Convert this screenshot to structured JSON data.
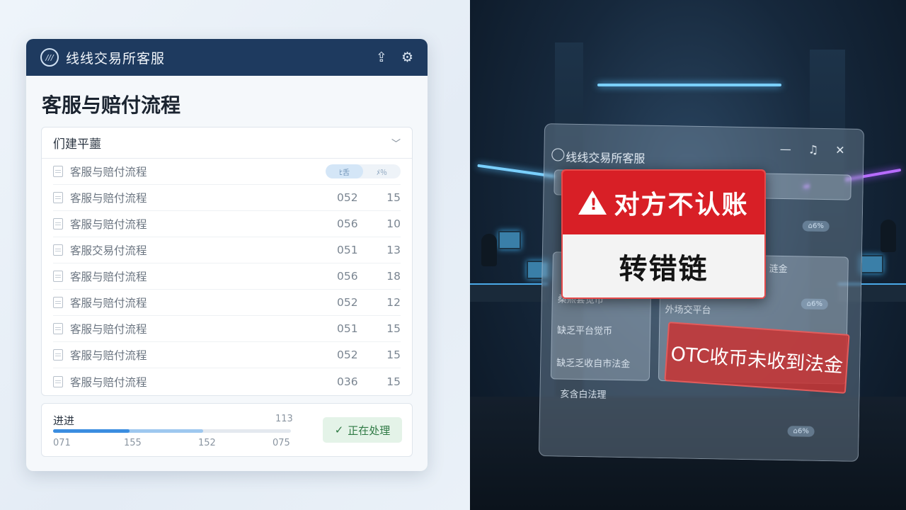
{
  "app": {
    "title": "线线交易所客服",
    "logo_text": "///",
    "share_icon": "share-icon",
    "settings_icon": "gear-icon"
  },
  "page_title": "客服与赔付流程",
  "dropdown": {
    "label": "们建平蘁"
  },
  "toggle": {
    "left": "ﾋ舌",
    "right": "ﾒ％"
  },
  "rows": [
    {
      "name": "客服与赔付流程",
      "c1": "",
      "c2": ""
    },
    {
      "name": "客服与赔付流程",
      "c1": "052",
      "c2": "15"
    },
    {
      "name": "客服与赔付流程",
      "c1": "056",
      "c2": "10"
    },
    {
      "name": "客服交易付流程",
      "c1": "051",
      "c2": "13"
    },
    {
      "name": "客服与赔付流程",
      "c1": "056",
      "c2": "18"
    },
    {
      "name": "客服与赔付流程",
      "c1": "052",
      "c2": "12"
    },
    {
      "name": "客服与赔付流程",
      "c1": "051",
      "c2": "15"
    },
    {
      "name": "客服与赔付流程",
      "c1": "052",
      "c2": "15"
    },
    {
      "name": "客服与赔付流程",
      "c1": "036",
      "c2": "15"
    }
  ],
  "progress": {
    "label": "进进",
    "total": "113",
    "fill_primary": 0.32,
    "fill_secondary": 0.63,
    "ticks": [
      "071",
      "155",
      "152",
      "075"
    ]
  },
  "status": {
    "label": "正在处理",
    "color": "#2f7a45"
  },
  "scene": {
    "ghost_title": "线线交易所客服",
    "ghost_items": [
      "桑熙套觉币",
      "缺乏平台觉币",
      "缺乏乏收自市法金",
      "亥含白法理",
      "外场交平台",
      "涟金"
    ],
    "ghost_pills": [
      "⌂6%",
      "⌂6%",
      "⌂6%"
    ],
    "alert_title": "对方不认账",
    "alert_sub": "转错链",
    "otc_text": "OTC收币未收到法金",
    "alert_color": "#d81f26"
  }
}
